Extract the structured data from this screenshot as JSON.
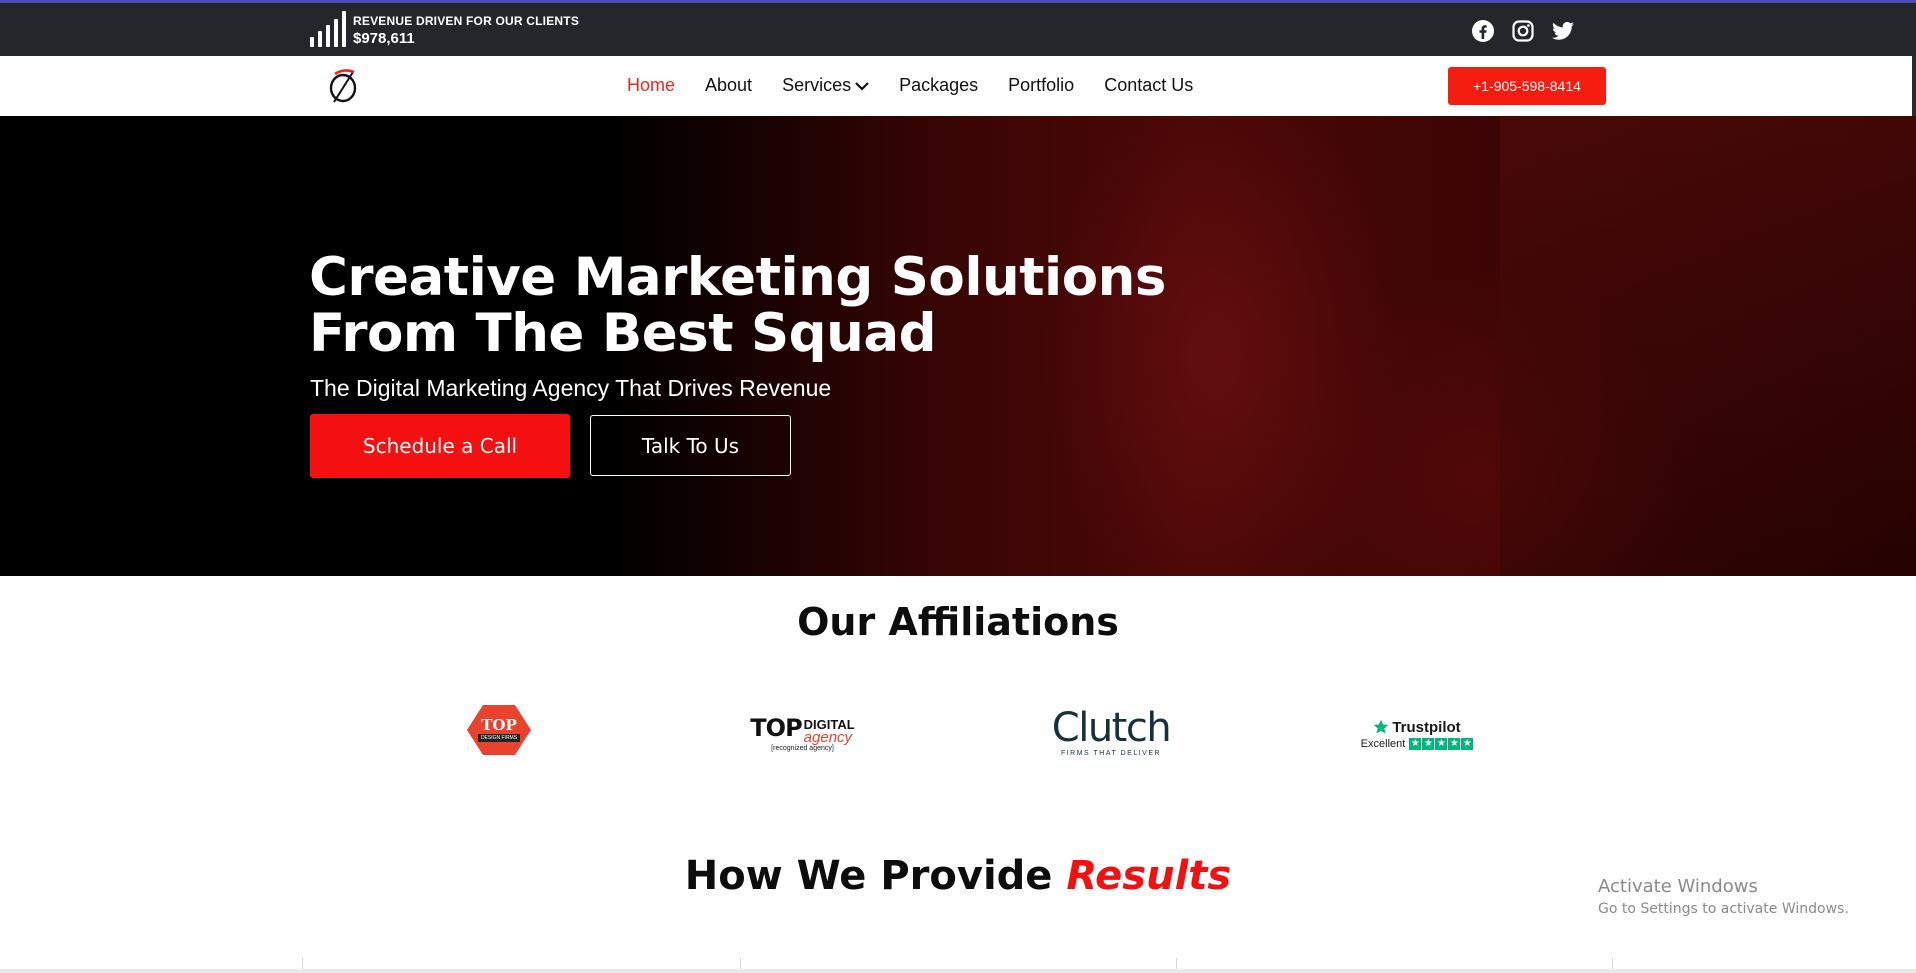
{
  "topbar": {
    "revenue_label": "REVENUE DRIVEN FOR OUR CLIENTS",
    "revenue_amount": "$978,611",
    "socials": [
      "facebook-icon",
      "instagram-icon",
      "twitter-icon"
    ]
  },
  "nav": {
    "items": [
      {
        "label": "Home",
        "active": true
      },
      {
        "label": "About"
      },
      {
        "label": "Services",
        "has_dropdown": true
      },
      {
        "label": "Packages"
      },
      {
        "label": "Portfolio"
      },
      {
        "label": "Contact Us"
      }
    ],
    "phone": "+1-905-598-8414"
  },
  "hero": {
    "title_line1": "Creative Marketing Solutions",
    "title_line2": "From The Best Squad",
    "subtitle": "The Digital Marketing Agency That Drives Revenue",
    "primary_button": "Schedule a Call",
    "secondary_button": "Talk To Us"
  },
  "affiliations": {
    "title": "Our Affiliations",
    "logos": {
      "top_design_firms": {
        "top": "TOP",
        "band": "DESIGN FIRMS"
      },
      "top_digital_agency": {
        "top": "TOP",
        "digital": "DIGITAL",
        "agency": "agency",
        "recognized": "[recognized agency]"
      },
      "clutch": {
        "word": "Clutch",
        "sub": "FIRMS THAT DELIVER"
      },
      "trustpilot": {
        "name": "Trustpilot",
        "rating": "Excellent"
      }
    }
  },
  "results": {
    "title_prefix": "How We Provide",
    "title_emphasis": "Results"
  },
  "windows_watermark": {
    "line1": "Activate Windows",
    "line2": "Go to Settings to activate Windows."
  },
  "colors": {
    "accent": "#f41010",
    "topbar_bg": "#24262b",
    "active_nav": "#e8281e"
  }
}
